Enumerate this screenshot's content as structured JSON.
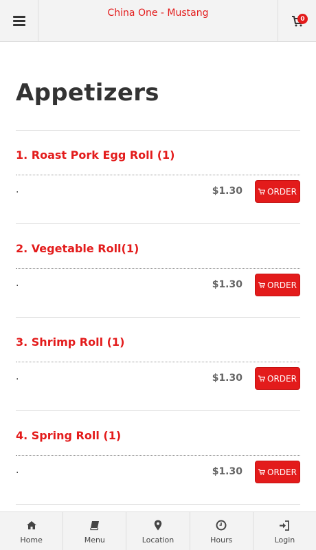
{
  "header": {
    "store_name": "China One - Mustang",
    "cart_count": "0"
  },
  "page": {
    "title": "Appetizers"
  },
  "items": [
    {
      "name": "1. Roast Pork Egg Roll (1)",
      "description": ".",
      "price": "$1.30",
      "order_label": "ORDER"
    },
    {
      "name": "2. Vegetable Roll(1)",
      "description": ".",
      "price": "$1.30",
      "order_label": "ORDER"
    },
    {
      "name": "3. Shrimp Roll (1)",
      "description": ".",
      "price": "$1.30",
      "order_label": "ORDER"
    },
    {
      "name": "4. Spring Roll (1)",
      "description": ".",
      "price": "$1.30",
      "order_label": "ORDER"
    }
  ],
  "footer": {
    "nav": [
      {
        "label": "Home",
        "icon": "home-icon"
      },
      {
        "label": "Menu",
        "icon": "book-icon"
      },
      {
        "label": "Location",
        "icon": "map-pin-icon"
      },
      {
        "label": "Hours",
        "icon": "clock-icon"
      },
      {
        "label": "Login",
        "icon": "login-icon"
      }
    ]
  },
  "colors": {
    "accent": "#e31b1b",
    "header_bg": "#f3f3f3",
    "title_text": "#333333"
  }
}
